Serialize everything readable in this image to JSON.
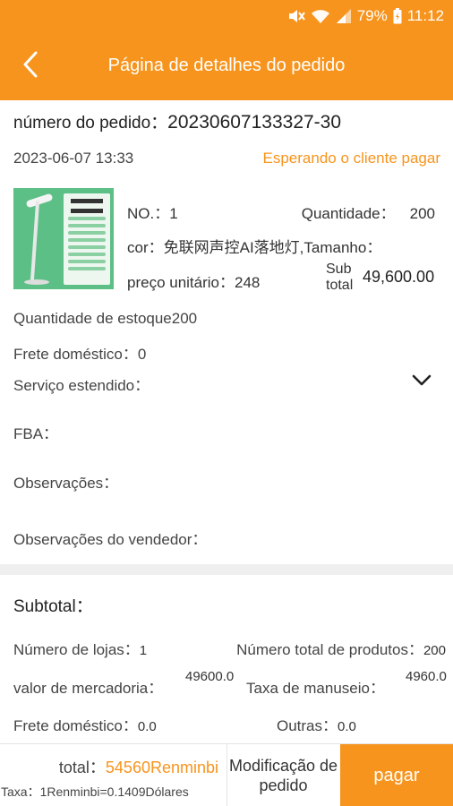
{
  "status_bar": {
    "battery": "79%",
    "time": "11:12"
  },
  "nav": {
    "title": "Página de detalhes do pedido"
  },
  "order": {
    "number_label": "número do pedido：",
    "number": "20230607133327-30",
    "date": "2023-06-07 13:33",
    "status": "Esperando o cliente pagar"
  },
  "product": {
    "no": "NO.：1",
    "quantity_label": "Quantidade：",
    "quantity": "200",
    "color": "cor：免联网声控AI落地灯,Tamanho：",
    "unit_price": "preço unitário：248",
    "subtotal_label": "Sub total",
    "subtotal": "49,600.00"
  },
  "details": {
    "stock": "Quantidade de estoque200",
    "freight": "Frete doméstico：0",
    "service": "Serviço estendido：",
    "fba": "FBA：",
    "observations": "Observações：",
    "seller_observations": "Observações do vendedor："
  },
  "summary": {
    "title": "Subtotal：",
    "stores_label": "Número de lojas：",
    "stores": "1",
    "products_label": "Número total de produtos：",
    "products": "200",
    "goods_label": "valor de mercadoria：",
    "goods": "49600.0",
    "handling_label": "Taxa de manuseio：",
    "handling": "4960.0",
    "freight_label": "Frete doméstico：",
    "freight": "0.0",
    "others_label": "Outras：",
    "others": "0.0"
  },
  "footer": {
    "total_label": "total：",
    "total": "54560Renminbi",
    "rate": "Taxa：1Renminbi=0.1409Dólares",
    "modify_button": "Modificação de pedido",
    "pay_button": "pagar"
  },
  "colors": {
    "accent": "#f7941d"
  },
  "icons": [
    "mute-icon",
    "wifi-icon",
    "signal-icon",
    "battery-icon",
    "back-arrow-icon",
    "chevron-down-icon"
  ]
}
